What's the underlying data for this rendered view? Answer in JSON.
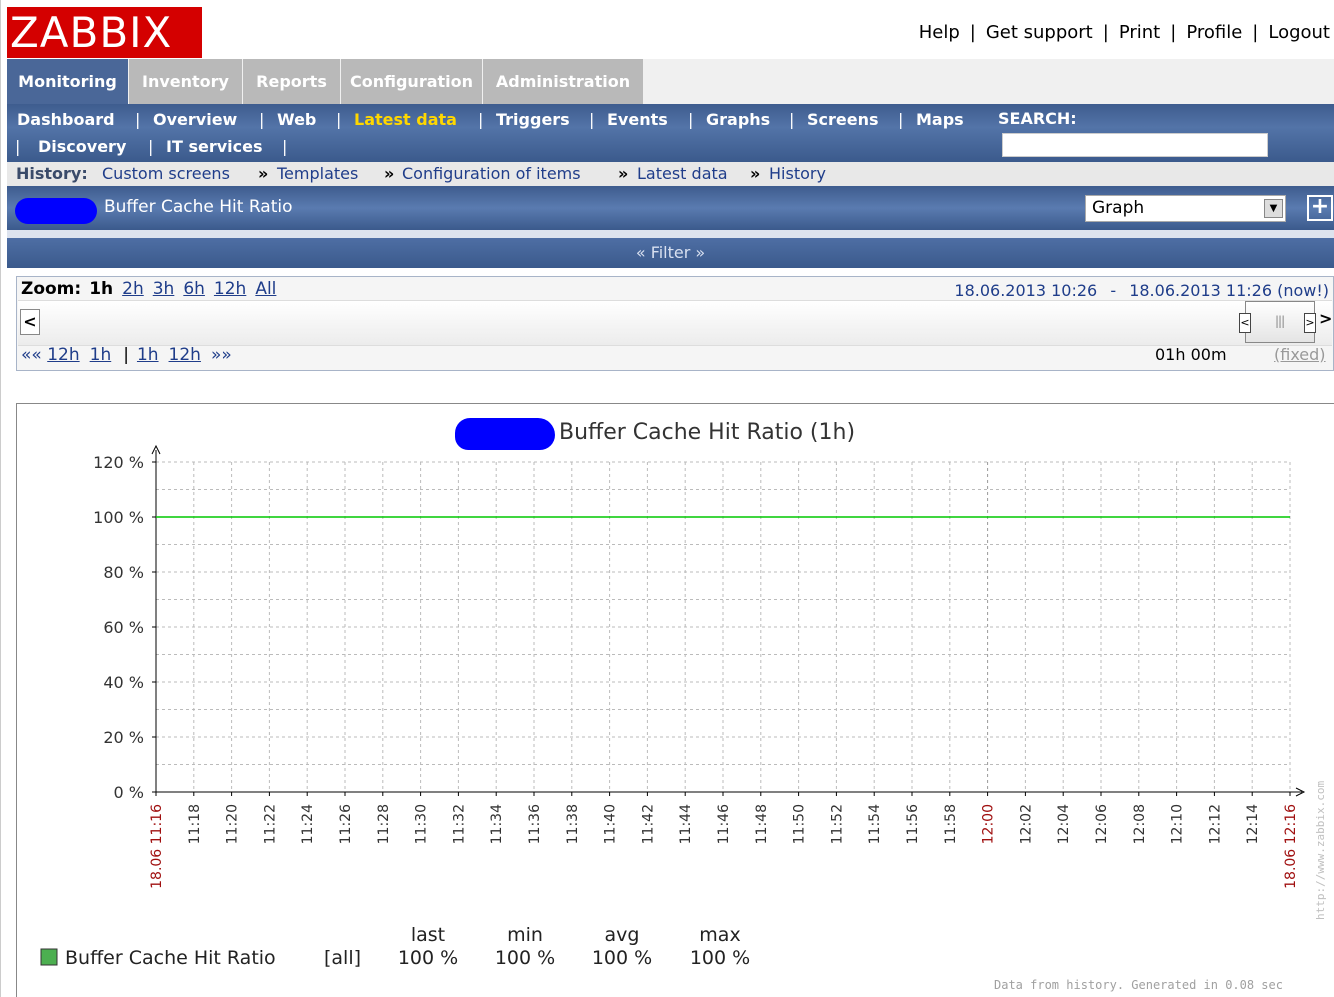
{
  "header": {
    "logo_text": "ZABBIX",
    "links": [
      "Help",
      "Get support",
      "Print",
      "Profile",
      "Logout"
    ]
  },
  "main_tabs": [
    {
      "label": "Monitoring",
      "active": true
    },
    {
      "label": "Inventory",
      "active": false
    },
    {
      "label": "Reports",
      "active": false
    },
    {
      "label": "Configuration",
      "active": false
    },
    {
      "label": "Administration",
      "active": false
    }
  ],
  "sub_nav": {
    "items": [
      "Dashboard",
      "Overview",
      "Web",
      "Latest data",
      "Triggers",
      "Events",
      "Graphs",
      "Screens",
      "Maps",
      "Discovery",
      "IT services"
    ],
    "active": "Latest data",
    "search_label": "SEARCH:",
    "search_value": ""
  },
  "history": {
    "label": "History:",
    "crumbs": [
      "Custom screens",
      "Templates",
      "Configuration of items",
      "Latest data",
      "History"
    ]
  },
  "title_bar": {
    "title": "Buffer Cache Hit Ratio",
    "view_select": "Graph",
    "add_button": "+"
  },
  "filter": {
    "label": "« Filter »"
  },
  "zoom": {
    "label": "Zoom:",
    "current": "1h",
    "options": [
      "2h",
      "3h",
      "6h",
      "12h",
      "All"
    ],
    "from": "18.06.2013 10:26",
    "dash": "-",
    "to": "18.06.2013 11:26 (now!)",
    "nav_back": [
      "««",
      "12h",
      "1h"
    ],
    "nav_fwd": [
      "1h",
      "12h",
      "»»"
    ],
    "period": "01h 00m",
    "fixed": "(fixed)"
  },
  "graph": {
    "title": "Buffer Cache Hit Ratio  (1h)"
  },
  "chart_data": {
    "type": "line",
    "title": "Buffer Cache Hit Ratio  (1h)",
    "y_ticks": [
      "0 %",
      "20 %",
      "40 %",
      "60 %",
      "80 %",
      "100 %",
      "120 %"
    ],
    "ylim": [
      0,
      120
    ],
    "x_ticks": [
      "18.06 11:16",
      "11:18",
      "11:20",
      "11:22",
      "11:24",
      "11:26",
      "11:28",
      "11:30",
      "11:32",
      "11:34",
      "11:36",
      "11:38",
      "11:40",
      "11:42",
      "11:44",
      "11:46",
      "11:48",
      "11:50",
      "11:52",
      "11:54",
      "11:56",
      "11:58",
      "12:00",
      "12:02",
      "12:04",
      "12:06",
      "12:08",
      "12:10",
      "12:12",
      "12:14",
      "18.06 12:16"
    ],
    "red_tick_labels": [
      "18.06 11:16",
      "12:00",
      "18.06 12:16"
    ],
    "grid": true,
    "series": [
      {
        "name": "Buffer Cache Hit Ratio",
        "color": "#00c800",
        "x": [
          "18.06 11:16",
          "18.06 12:16"
        ],
        "values": [
          100,
          100
        ]
      }
    ],
    "legend": {
      "item": "Buffer Cache Hit Ratio",
      "scope": "[all]",
      "headers": [
        "last",
        "min",
        "avg",
        "max"
      ],
      "values": [
        "100 %",
        "100 %",
        "100 %",
        "100 %"
      ]
    }
  },
  "footer": {
    "text": "Data from history. Generated in 0.08 sec",
    "watermark": "http://www.zabbix.com"
  },
  "colors": {
    "logo_red": "#d40000",
    "nav_blue": "#3e5c8e",
    "active_nav": "#ffd700",
    "series_green": "#00c800",
    "legend_square": "#4caf50"
  }
}
